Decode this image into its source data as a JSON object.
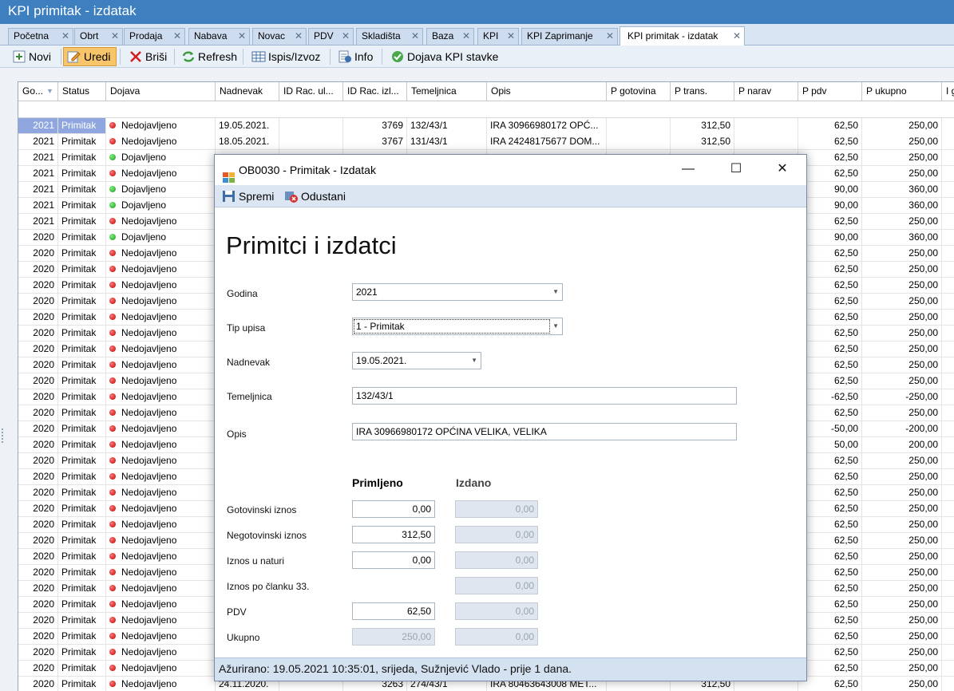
{
  "window": {
    "title": "KPI primitak - izdatak"
  },
  "tabs": [
    {
      "label": "Početna"
    },
    {
      "label": "Obrt"
    },
    {
      "label": "Prodaja"
    },
    {
      "label": "Nabava"
    },
    {
      "label": "Novac"
    },
    {
      "label": "PDV"
    },
    {
      "label": "Skladišta"
    },
    {
      "label": "Baza"
    },
    {
      "label": "KPI"
    },
    {
      "label": "KPI Zaprimanje"
    },
    {
      "label": "KPI primitak - izdatak"
    }
  ],
  "toolbar": {
    "novi": "Novi",
    "uredi": "Uredi",
    "brisi": "Briši",
    "refresh": "Refresh",
    "ispis": "Ispis/Izvoz",
    "info": "Info",
    "dojava": "Dojava KPI stavke"
  },
  "grid": {
    "headers": [
      "Go...",
      "Status",
      "Dojava",
      "Nadnevak",
      "ID Rac. ul...",
      "ID Rac. izl...",
      "Temeljnica",
      "Opis",
      "P gotovina",
      "P trans.",
      "P narav",
      "P pdv",
      "P ukupno",
      "I g"
    ],
    "rows": [
      {
        "god": "2021",
        "status": "Primitak",
        "dojava": "Nedojavljeno",
        "dot": "red",
        "nad": "19.05.2021.",
        "izl": "3769",
        "tem": "132/43/1",
        "opis": "IRA 30966980172 OPĆ...",
        "trans": "312,50",
        "pdv": "62,50",
        "uk": "250,00",
        "sel": true
      },
      {
        "god": "2021",
        "status": "Primitak",
        "dojava": "Nedojavljeno",
        "dot": "red",
        "nad": "18.05.2021.",
        "izl": "3767",
        "tem": "131/43/1",
        "opis": "IRA 24248175677 DOM...",
        "trans": "312,50",
        "pdv": "62,50",
        "uk": "250,00"
      },
      {
        "god": "2021",
        "status": "Primitak",
        "dojava": "Dojavljeno",
        "dot": "green",
        "pdv": "62,50",
        "uk": "250,00"
      },
      {
        "god": "2021",
        "status": "Primitak",
        "dojava": "Nedojavljeno",
        "dot": "red",
        "pdv": "62,50",
        "uk": "250,00"
      },
      {
        "god": "2021",
        "status": "Primitak",
        "dojava": "Dojavljeno",
        "dot": "green",
        "pdv": "90,00",
        "uk": "360,00"
      },
      {
        "god": "2021",
        "status": "Primitak",
        "dojava": "Dojavljeno",
        "dot": "green",
        "pdv": "90,00",
        "uk": "360,00"
      },
      {
        "god": "2021",
        "status": "Primitak",
        "dojava": "Nedojavljeno",
        "dot": "red",
        "pdv": "62,50",
        "uk": "250,00"
      },
      {
        "god": "2020",
        "status": "Primitak",
        "dojava": "Dojavljeno",
        "dot": "green",
        "pdv": "90,00",
        "uk": "360,00"
      },
      {
        "god": "2020",
        "status": "Primitak",
        "dojava": "Nedojavljeno",
        "dot": "red",
        "pdv": "62,50",
        "uk": "250,00"
      },
      {
        "god": "2020",
        "status": "Primitak",
        "dojava": "Nedojavljeno",
        "dot": "red",
        "pdv": "62,50",
        "uk": "250,00"
      },
      {
        "god": "2020",
        "status": "Primitak",
        "dojava": "Nedojavljeno",
        "dot": "red",
        "pdv": "62,50",
        "uk": "250,00"
      },
      {
        "god": "2020",
        "status": "Primitak",
        "dojava": "Nedojavljeno",
        "dot": "red",
        "pdv": "62,50",
        "uk": "250,00"
      },
      {
        "god": "2020",
        "status": "Primitak",
        "dojava": "Nedojavljeno",
        "dot": "red",
        "pdv": "62,50",
        "uk": "250,00"
      },
      {
        "god": "2020",
        "status": "Primitak",
        "dojava": "Nedojavljeno",
        "dot": "red",
        "pdv": "62,50",
        "uk": "250,00"
      },
      {
        "god": "2020",
        "status": "Primitak",
        "dojava": "Nedojavljeno",
        "dot": "red",
        "pdv": "62,50",
        "uk": "250,00"
      },
      {
        "god": "2020",
        "status": "Primitak",
        "dojava": "Nedojavljeno",
        "dot": "red",
        "pdv": "62,50",
        "uk": "250,00"
      },
      {
        "god": "2020",
        "status": "Primitak",
        "dojava": "Nedojavljeno",
        "dot": "red",
        "pdv": "62,50",
        "uk": "250,00"
      },
      {
        "god": "2020",
        "status": "Primitak",
        "dojava": "Nedojavljeno",
        "dot": "red",
        "pdv": "-62,50",
        "uk": "-250,00"
      },
      {
        "god": "2020",
        "status": "Primitak",
        "dojava": "Nedojavljeno",
        "dot": "red",
        "pdv": "62,50",
        "uk": "250,00"
      },
      {
        "god": "2020",
        "status": "Primitak",
        "dojava": "Nedojavljeno",
        "dot": "red",
        "pdv": "-50,00",
        "uk": "-200,00"
      },
      {
        "god": "2020",
        "status": "Primitak",
        "dojava": "Nedojavljeno",
        "dot": "red",
        "pdv": "50,00",
        "uk": "200,00"
      },
      {
        "god": "2020",
        "status": "Primitak",
        "dojava": "Nedojavljeno",
        "dot": "red",
        "pdv": "62,50",
        "uk": "250,00"
      },
      {
        "god": "2020",
        "status": "Primitak",
        "dojava": "Nedojavljeno",
        "dot": "red",
        "pdv": "62,50",
        "uk": "250,00"
      },
      {
        "god": "2020",
        "status": "Primitak",
        "dojava": "Nedojavljeno",
        "dot": "red",
        "pdv": "62,50",
        "uk": "250,00"
      },
      {
        "god": "2020",
        "status": "Primitak",
        "dojava": "Nedojavljeno",
        "dot": "red",
        "pdv": "62,50",
        "uk": "250,00"
      },
      {
        "god": "2020",
        "status": "Primitak",
        "dojava": "Nedojavljeno",
        "dot": "red",
        "pdv": "62,50",
        "uk": "250,00"
      },
      {
        "god": "2020",
        "status": "Primitak",
        "dojava": "Nedojavljeno",
        "dot": "red",
        "pdv": "62,50",
        "uk": "250,00"
      },
      {
        "god": "2020",
        "status": "Primitak",
        "dojava": "Nedojavljeno",
        "dot": "red",
        "pdv": "62,50",
        "uk": "250,00"
      },
      {
        "god": "2020",
        "status": "Primitak",
        "dojava": "Nedojavljeno",
        "dot": "red",
        "pdv": "62,50",
        "uk": "250,00"
      },
      {
        "god": "2020",
        "status": "Primitak",
        "dojava": "Nedojavljeno",
        "dot": "red",
        "pdv": "62,50",
        "uk": "250,00"
      },
      {
        "god": "2020",
        "status": "Primitak",
        "dojava": "Nedojavljeno",
        "dot": "red",
        "pdv": "62,50",
        "uk": "250,00"
      },
      {
        "god": "2020",
        "status": "Primitak",
        "dojava": "Nedojavljeno",
        "dot": "red",
        "pdv": "62,50",
        "uk": "250,00"
      },
      {
        "god": "2020",
        "status": "Primitak",
        "dojava": "Nedojavljeno",
        "dot": "red",
        "pdv": "62,50",
        "uk": "250,00"
      },
      {
        "god": "2020",
        "status": "Primitak",
        "dojava": "Nedojavljeno",
        "dot": "red",
        "pdv": "62,50",
        "uk": "250,00"
      },
      {
        "god": "2020",
        "status": "Primitak",
        "dojava": "Nedojavljeno",
        "dot": "red",
        "pdv": "62,50",
        "uk": "250,00"
      },
      {
        "god": "2020",
        "status": "Primitak",
        "dojava": "Nedojavljeno",
        "dot": "red",
        "nad": "24.11.2020.",
        "izl": "3263",
        "tem": "274/43/1",
        "opis": "IRA 80463643008 MET...",
        "trans": "312,50",
        "pdv": "62,50",
        "uk": "250,00"
      }
    ]
  },
  "dialog": {
    "title": "OB0030 - Primitak - Izdatak",
    "spremi": "Spremi",
    "odustani": "Odustani",
    "heading": "Primitci i izdatci",
    "godina_label": "Godina",
    "godina_value": "2021",
    "tip_label": "Tip upisa",
    "tip_value": "1 - Primitak",
    "nadnevak_label": "Nadnevak",
    "nadnevak_value": "19.05.2021.",
    "temeljnica_label": "Temeljnica",
    "temeljnica_value": "132/43/1",
    "opis_label": "Opis",
    "opis_value": "IRA 30966980172 OPĆINA VELIKA, VELIKA",
    "col_primljeno": "Primljeno",
    "col_izdano": "Izdano",
    "amounts": [
      {
        "label": "Gotovinski iznos",
        "prim": "0,00",
        "izd": "0,00"
      },
      {
        "label": "Negotovinski iznos",
        "prim": "312,50",
        "izd": "0,00"
      },
      {
        "label": "Iznos u naturi",
        "prim": "0,00",
        "izd": "0,00"
      },
      {
        "label": "Iznos po članku 33.",
        "prim": null,
        "izd": "0,00"
      },
      {
        "label": "PDV",
        "prim": "62,50",
        "izd": "0,00"
      },
      {
        "label": "Ukupno",
        "prim": "250,00",
        "izd": "0,00"
      }
    ],
    "status": "Ažurirano: 19.05.2021 10:35:01, srijeda, Sužnjević Vlado -  prije 1 dana."
  }
}
